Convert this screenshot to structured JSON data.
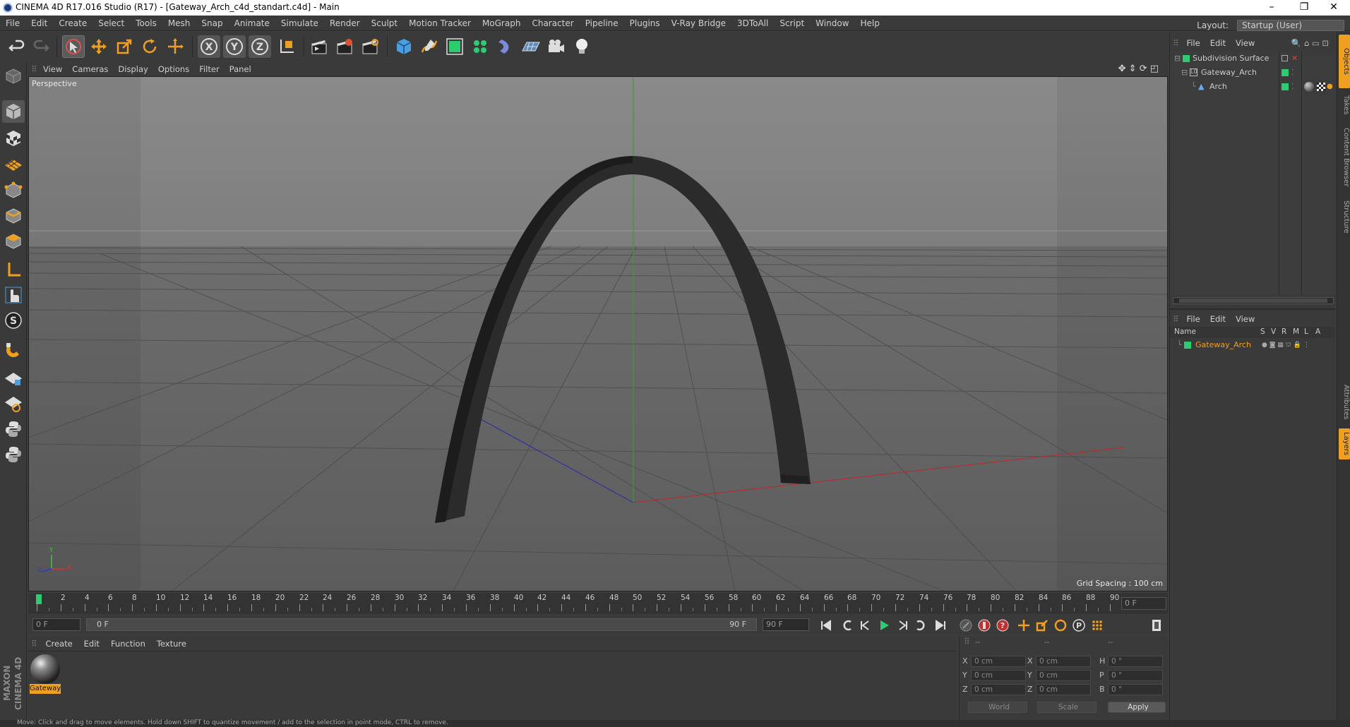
{
  "window": {
    "title": "CINEMA 4D R17.016 Studio (R17) - [Gateway_Arch_c4d_standart.c4d] - Main",
    "controls": [
      "–",
      "❐",
      "✕"
    ]
  },
  "menu": [
    "File",
    "Edit",
    "Create",
    "Select",
    "Tools",
    "Mesh",
    "Snap",
    "Animate",
    "Simulate",
    "Render",
    "Sculpt",
    "Motion Tracker",
    "MoGraph",
    "Character",
    "Pipeline",
    "Plugins",
    "V-Ray Bridge",
    "3DToAll",
    "Script",
    "Window",
    "Help"
  ],
  "layout": {
    "label": "Layout:",
    "value": "Startup (User)"
  },
  "viewport": {
    "menu": [
      "View",
      "Cameras",
      "Display",
      "Options",
      "Filter",
      "Panel"
    ],
    "label": "Perspective",
    "grid_spacing": "Grid Spacing : 100 cm",
    "axis_x": "X",
    "axis_y": "Y",
    "axis_z": "Z"
  },
  "timeline": {
    "ticks": [
      "0",
      "2",
      "4",
      "6",
      "8",
      "10",
      "12",
      "14",
      "16",
      "18",
      "20",
      "22",
      "24",
      "26",
      "28",
      "30",
      "32",
      "34",
      "36",
      "38",
      "40",
      "42",
      "44",
      "46",
      "48",
      "50",
      "52",
      "54",
      "56",
      "58",
      "60",
      "62",
      "64",
      "66",
      "68",
      "70",
      "72",
      "74",
      "76",
      "78",
      "80",
      "82",
      "84",
      "86",
      "88",
      "90"
    ],
    "current": "0 F"
  },
  "controls": {
    "start": "0 F",
    "range_start": "0 F",
    "range_end": "90 F",
    "end": "90 F"
  },
  "material": {
    "menu": [
      "Create",
      "Edit",
      "Function",
      "Texture"
    ],
    "items": [
      {
        "name": "Gateway"
      }
    ]
  },
  "coordinates": {
    "header": [
      "--",
      "--",
      "--"
    ],
    "rows": [
      {
        "a": "X",
        "av": "0 cm",
        "b": "X",
        "bv": "0 cm",
        "c": "H",
        "cv": "0 °"
      },
      {
        "a": "Y",
        "av": "0 cm",
        "b": "Y",
        "bv": "0 cm",
        "c": "P",
        "cv": "0 °"
      },
      {
        "a": "Z",
        "av": "0 cm",
        "b": "Z",
        "bv": "0 cm",
        "c": "B",
        "cv": "0 °"
      }
    ],
    "mode1": "World",
    "mode2": "Scale",
    "apply": "Apply"
  },
  "objects": {
    "menu": [
      "File",
      "Edit",
      "View"
    ],
    "items": [
      {
        "name": "Subdivision Surface",
        "indent": 0
      },
      {
        "name": "Gateway_Arch",
        "indent": 1
      },
      {
        "name": "Arch",
        "indent": 2
      }
    ]
  },
  "layers": {
    "menu": [
      "File",
      "Edit",
      "View"
    ],
    "columns": [
      "Name",
      "S",
      "V",
      "R",
      "M",
      "L",
      "A"
    ],
    "items": [
      {
        "name": "Gateway_Arch"
      }
    ]
  },
  "side_tabs": [
    "Objects",
    "Takes",
    "Content Browser",
    "Structure"
  ],
  "side_tabs2": [
    "Attributes",
    "Layers"
  ],
  "status": "Move: Click and drag to move elements. Hold down SHIFT to quantize movement / add to the selection in point mode, CTRL to remove.",
  "brand": "MAXON CINEMA 4D",
  "colors": {
    "accent": "#f0a020",
    "green": "#2ecc71",
    "viewport": "#787878"
  }
}
